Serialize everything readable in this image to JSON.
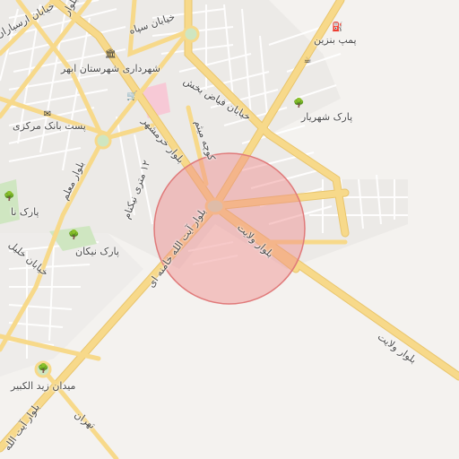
{
  "map": {
    "zoom_circle_color": "#f08a8a",
    "road_color": "#f7d98a",
    "road_edge_color": "#e9c56c",
    "park_color": "#cfe6c1",
    "hospital_color": "#f7c9d6"
  },
  "labels": {
    "street_arsaran": "خیابان ارسباران",
    "street_sepah": "خیابان سپاه",
    "gas_station": "پمپ بنزین",
    "municipality": "شهرداری شهرستان ابهر",
    "bvd_top": "بلوار",
    "fayaz": "خیابان فیاض بخش",
    "shahryar_park": "پارک شهریار",
    "post_bank": "پست بانک مرکزی",
    "khoramshahr": "بلوار خرمشهر",
    "koocheh": "کوچه میثم",
    "moalem": "بلوار معلم",
    "niknam_st": "۱۲ متری نیکنام",
    "park_niknam_left": "پارک نا",
    "khalil": "خیابان خلیل",
    "khamenei_a": "بلوار آیت الله خامنه ای",
    "velayat_a": "بلوار ولایت",
    "niknam_park": "پارک نیکان",
    "velayat_b": "بلوار ولایت",
    "zeyd_square": "میدان زید الکبیر",
    "tehran": "تهران",
    "khamenei_b": "بلوار آیت الله"
  },
  "icons": {
    "gas": "fuel-icon",
    "museum": "museum-icon",
    "cafe": "cafe-icon",
    "shop": "shop-icon",
    "post": "envelope-icon",
    "park": "tree-icon"
  }
}
